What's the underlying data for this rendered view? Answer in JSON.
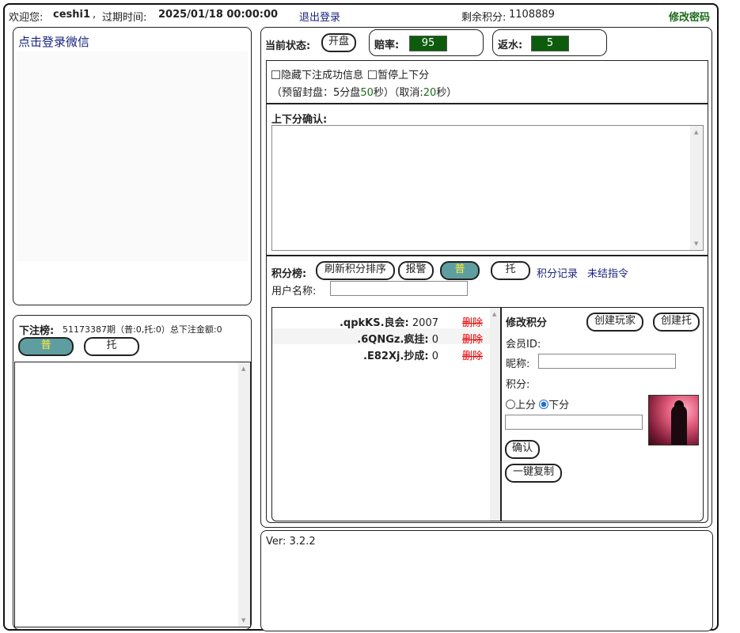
{
  "header": {
    "welcome_label": "欢迎您:",
    "username": "ceshi1",
    "sep": ",",
    "expire_label": "过期时间:",
    "expire_value": "2025/01/18 00:00:00",
    "logout": "退出登录",
    "points_label": "剩余积分:",
    "points_value": "1108889",
    "change_password": "修改密码"
  },
  "wechat": {
    "login_link": "点击登录微信"
  },
  "bets": {
    "label": "下注榜:",
    "info": "51173387期（普:0,托:0）总下注金额:0",
    "tab_normal": "普",
    "tab_tuo": "托"
  },
  "status": {
    "label": "当前状态:",
    "state_button": "开盘",
    "odds_label": "赔率:",
    "odds_value": "95",
    "rebate_label": "返水:",
    "rebate_value": "5"
  },
  "options": {
    "hide_success": "隐藏下注成功信息",
    "pause_updown": "暂停上下分",
    "reserve_prefix": "（预留封盘：",
    "reserve_min": "5",
    "reserve_min_unit": "分盘",
    "reserve_sec": "50",
    "reserve_sec_unit": "秒）（取消:",
    "cancel_sec": "20",
    "cancel_sec_unit": "秒）"
  },
  "confirm": {
    "label": "上下分确认:"
  },
  "rank": {
    "label": "积分榜:",
    "refresh": "刷新积分排序",
    "alarm": "报警",
    "tab_normal": "普",
    "tab_tuo": "托",
    "records_link": "积分记录",
    "pending_link": "未结指令",
    "username_label": "用户名称:",
    "delete_label": "删除",
    "rows": [
      {
        "name": ".qpkKS.良会:",
        "score": "2007"
      },
      {
        "name": ".6QNGz.疯挂:",
        "score": "0"
      },
      {
        "name": ".E82Xj.抄成:",
        "score": "0"
      }
    ]
  },
  "edit": {
    "title": "修改积分",
    "create_player": "创建玩家",
    "create_tuo": "创建托",
    "member_id_label": "会员ID:",
    "nickname_label": "昵称:",
    "points_label": "积分:",
    "up_label": "上分",
    "down_label": "下分",
    "confirm": "确认",
    "copy": "一键复制"
  },
  "version": "Ver: 3.2.2"
}
